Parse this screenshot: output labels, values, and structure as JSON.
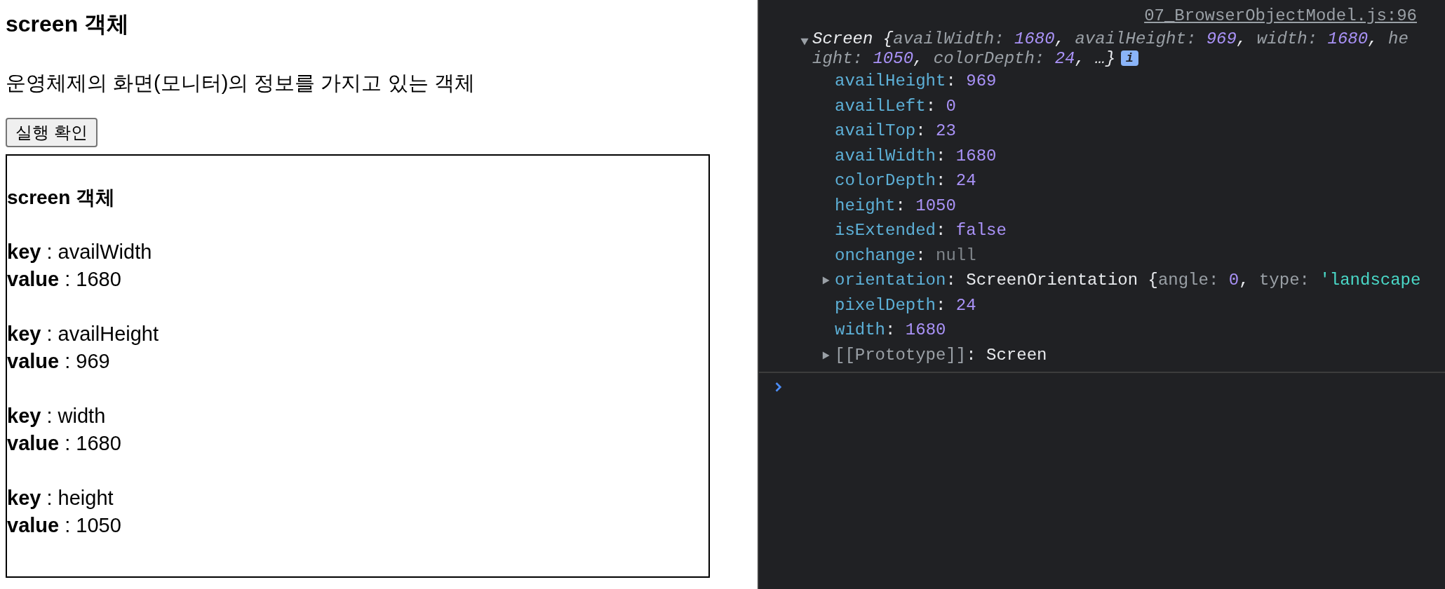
{
  "page": {
    "heading": "screen 객체",
    "description": "운영체제의 화면(모니터)의 정보를 가지고 있는 객체",
    "run_button": "실행 확인",
    "output": {
      "heading": "screen 객체",
      "entries": [
        {
          "key_label": "key",
          "separator": ":",
          "key": "availWidth",
          "value_label": "value",
          "value": "1680"
        },
        {
          "key_label": "key",
          "separator": ":",
          "key": "availHeight",
          "value_label": "value",
          "value": "969"
        },
        {
          "key_label": "key",
          "separator": ":",
          "key": "width",
          "value_label": "value",
          "value": "1680"
        },
        {
          "key_label": "key",
          "separator": ":",
          "key": "height",
          "value_label": "value",
          "value": "1050"
        }
      ]
    }
  },
  "console": {
    "source_link": "07_BrowserObjectModel.js:96",
    "log": {
      "expanded": true,
      "summary_lines": [
        [
          {
            "kind": "plain",
            "text": "Screen {"
          },
          {
            "kind": "key",
            "text": "availWidth: "
          },
          {
            "kind": "number",
            "text": "1680"
          },
          {
            "kind": "plain",
            "text": ", "
          },
          {
            "kind": "key",
            "text": "availHeight: "
          },
          {
            "kind": "number",
            "text": "969"
          },
          {
            "kind": "plain",
            "text": ", "
          },
          {
            "kind": "key",
            "text": "width: "
          },
          {
            "kind": "number",
            "text": "1680"
          },
          {
            "kind": "plain",
            "text": ", "
          },
          {
            "kind": "key",
            "text": "he"
          }
        ],
        [
          {
            "kind": "key",
            "text": "ight: "
          },
          {
            "kind": "number",
            "text": "1050"
          },
          {
            "kind": "plain",
            "text": ", "
          },
          {
            "kind": "key",
            "text": "colorDepth: "
          },
          {
            "kind": "number",
            "text": "24"
          },
          {
            "kind": "plain",
            "text": ", …}"
          }
        ]
      ],
      "info_badge": "i",
      "properties": [
        {
          "key": "availHeight",
          "separator": ": ",
          "kind": "number",
          "value": "969"
        },
        {
          "key": "availLeft",
          "separator": ": ",
          "kind": "number",
          "value": "0"
        },
        {
          "key": "availTop",
          "separator": ": ",
          "kind": "number",
          "value": "23"
        },
        {
          "key": "availWidth",
          "separator": ": ",
          "kind": "number",
          "value": "1680"
        },
        {
          "key": "colorDepth",
          "separator": ": ",
          "kind": "number",
          "value": "24"
        },
        {
          "key": "height",
          "separator": ": ",
          "kind": "number",
          "value": "1050"
        },
        {
          "key": "isExtended",
          "separator": ": ",
          "kind": "boolean",
          "value": "false"
        },
        {
          "key": "onchange",
          "separator": ": ",
          "kind": "null",
          "value": "null"
        },
        {
          "key": "orientation",
          "separator": ": ",
          "kind": "object",
          "expanded": false,
          "preview": [
            {
              "kind": "plain",
              "text": "ScreenOrientation {"
            },
            {
              "kind": "key",
              "text": "angle: "
            },
            {
              "kind": "number",
              "text": "0"
            },
            {
              "kind": "plain",
              "text": ", "
            },
            {
              "kind": "key",
              "text": "type: "
            },
            {
              "kind": "string",
              "text": "'landscape"
            }
          ]
        },
        {
          "key": "pixelDepth",
          "separator": ": ",
          "kind": "number",
          "value": "24"
        },
        {
          "key": "width",
          "separator": ": ",
          "kind": "number",
          "value": "1680"
        },
        {
          "key": "[[Prototype]]",
          "separator": ": ",
          "kind": "prototype",
          "expanded": false,
          "value": "Screen"
        }
      ]
    }
  }
}
